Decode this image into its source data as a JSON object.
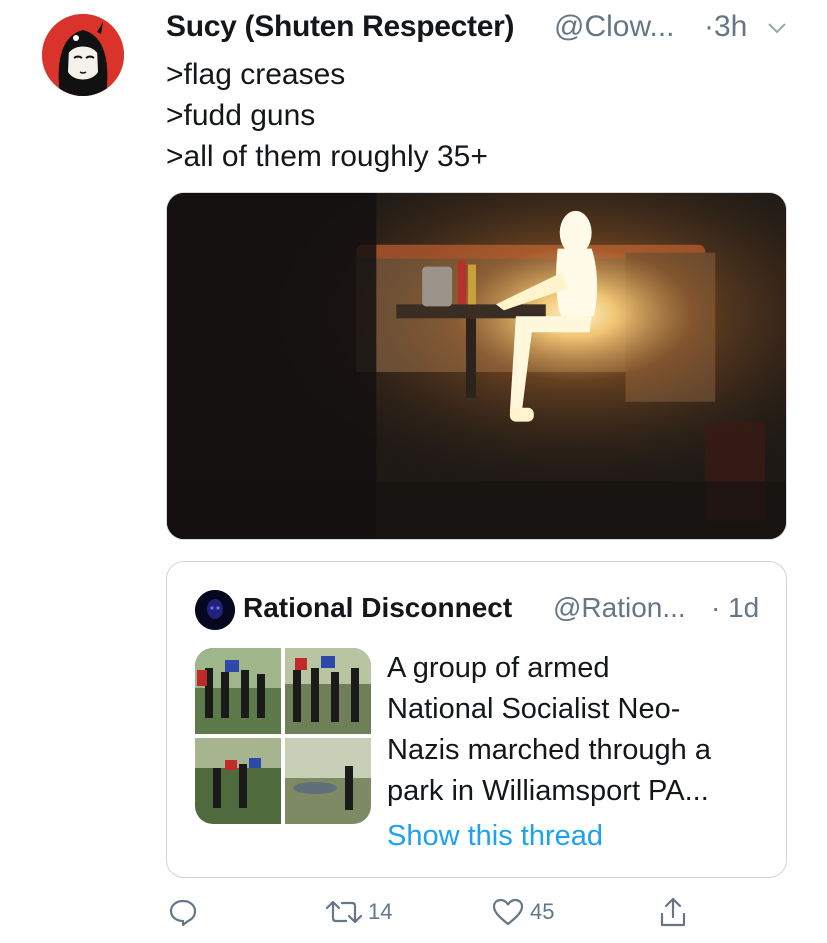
{
  "tweet": {
    "author_name": "Sucy (Shuten Respecter)",
    "author_handle": "@Clow...",
    "time": "·3h",
    "lines": [
      ">flag creases",
      ">fudd guns",
      ">all of them roughly 35+"
    ]
  },
  "quoted": {
    "author_name": "Rational Disconnect",
    "author_handle": "@Ration...",
    "time": "· 1d",
    "lines": [
      "A group of armed",
      "National Socialist Neo-",
      "Nazis marched through a",
      "park in Williamsport PA..."
    ],
    "show_thread": "Show this thread"
  },
  "actions": {
    "reply": {
      "icon": "reply-icon"
    },
    "retweet": {
      "icon": "retweet-icon",
      "count": "14"
    },
    "like": {
      "icon": "heart-icon",
      "count": "45"
    },
    "share": {
      "icon": "share-icon"
    }
  },
  "colors": {
    "text": "#14171a",
    "secondary": "#657786",
    "link": "#1da1f2",
    "border": "#ccd6dd"
  }
}
